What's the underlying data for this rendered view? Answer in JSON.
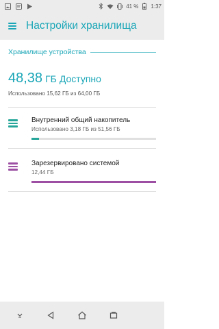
{
  "status_bar": {
    "battery": "41 %",
    "time": "1:37",
    "icons": [
      "gallery-icon",
      "notification-icon",
      "play-store-icon",
      "bluetooth-icon",
      "wifi-icon",
      "vibrate-icon",
      "battery-icon"
    ]
  },
  "app_bar": {
    "title": "Настройки хранилища",
    "menu_icon": "menu-icon"
  },
  "section": {
    "title": "Хранилище устройства"
  },
  "summary": {
    "available_value": "48,38",
    "available_unit": "ГБ",
    "available_label": "Доступно",
    "used_text": "Использовано 15,62 ГБ из 64,00 ГБ"
  },
  "storage_items": [
    {
      "title": "Внутренний общий накопитель",
      "subtitle": "Использовано 3,18 ГБ из 51,56 ГБ",
      "fill_fraction": 0.0617,
      "color": "#26a69a",
      "icon": "storage-icon"
    },
    {
      "title": "Зарезервировано системой",
      "subtitle": "12,44 ГБ",
      "fill_fraction": 1.0,
      "color": "#9c4fa3",
      "icon": "system-storage-icon"
    }
  ],
  "nav_bar": {
    "icons": [
      "hide-keyboard-icon",
      "back-icon",
      "home-icon",
      "recents-icon"
    ]
  },
  "colors": {
    "accent": "#1aa6b7",
    "internal": "#26a69a",
    "system": "#9c4fa3"
  }
}
